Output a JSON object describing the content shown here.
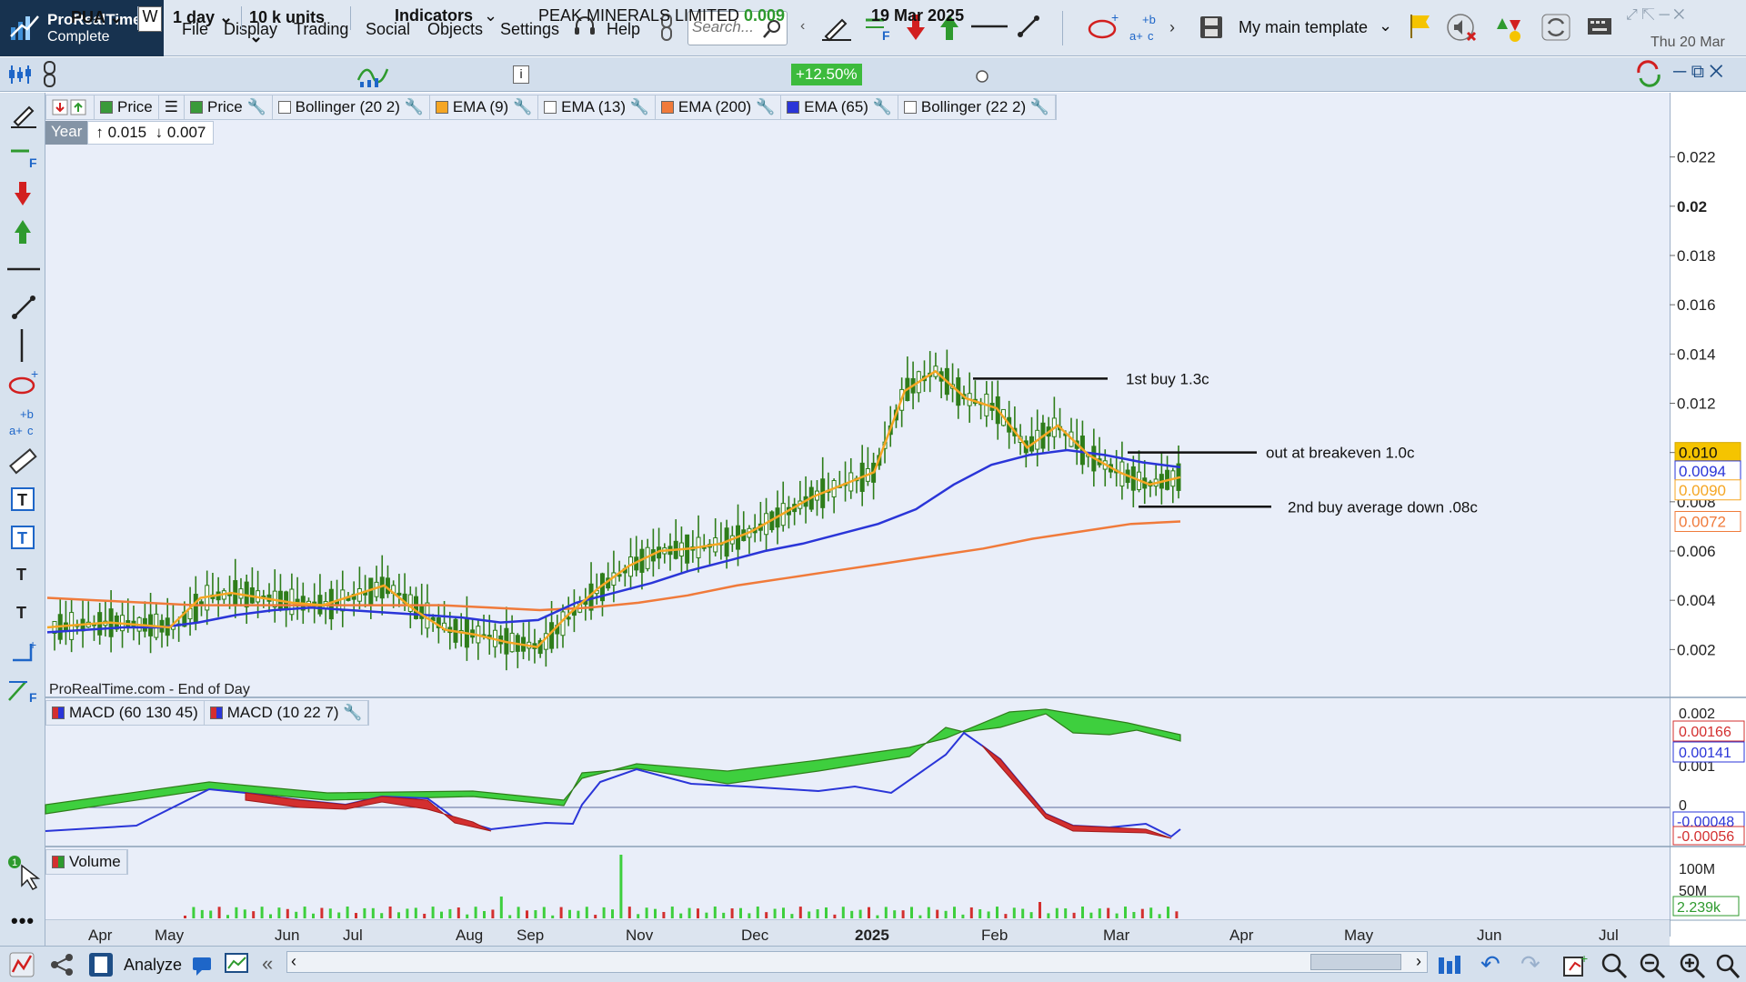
{
  "app": {
    "name": "ProRealTime",
    "edition": "Complete"
  },
  "menu": [
    "File",
    "Display",
    "Trading",
    "Social",
    "Objects",
    "Settings"
  ],
  "help_label": "Help",
  "search": {
    "placeholder": "Search..."
  },
  "template": "My main template",
  "date_label": "Thu 20 Mar",
  "toolbar": {
    "symbol": "PUA",
    "period_prefix": "W",
    "interval": "1 day",
    "units": "10 k units",
    "indicators_label": "Indicators",
    "instrument_name": "PEAK MINERALS LIMITED",
    "last_price": "0.009",
    "change_pct": "+12.50%",
    "bar_date": "19 Mar 2025"
  },
  "colors": {
    "up_bar": "#2e7d1a",
    "ema9": "#f5a623",
    "ema65": "#2a35d8",
    "ema200": "#f07a3a",
    "macd_fill_pos": "#3ecf3e",
    "macd_fill_neg": "#d32f2f",
    "accent": "#17324f"
  },
  "legend": [
    {
      "label": "Price",
      "swatch": "#3a9a3a"
    },
    {
      "label": "Price",
      "swatch": "#3a9a3a"
    },
    {
      "label": "Bollinger (20 2)",
      "swatch": "#ffffff"
    },
    {
      "label": "EMA (9)",
      "swatch": "#f5a623"
    },
    {
      "label": "EMA (13)",
      "swatch": "#ffffff"
    },
    {
      "label": "EMA (200)",
      "swatch": "#f07a3a"
    },
    {
      "label": "EMA (65)",
      "swatch": "#2a35d8"
    },
    {
      "label": "Bollinger (22 2)",
      "swatch": "#ffffff"
    }
  ],
  "range": {
    "label": "Year",
    "high": "0.015",
    "low": "0.007"
  },
  "footnote": "ProRealTime.com - End of Day",
  "macd_legend": [
    "MACD (60 130 45)",
    "MACD (10 22 7)"
  ],
  "volume_legend": "Volume",
  "bottom": {
    "analyze_label": "Analyze"
  },
  "chart_data": {
    "type": "candlestick",
    "price_axis": {
      "ticks": [
        "0.022",
        "0.02",
        "0.018",
        "0.016",
        "0.014",
        "0.012",
        "0.010",
        "0.008",
        "0.006",
        "0.004",
        "0.002"
      ],
      "ylim": [
        0.0005,
        0.0235
      ]
    },
    "x_labels": [
      "Apr",
      "May",
      "Jun",
      "Jul",
      "Aug",
      "Sep",
      "Nov",
      "Dec",
      "2025",
      "Feb",
      "Mar",
      "Apr",
      "May",
      "Jun",
      "Jul"
    ],
    "price_tags": [
      {
        "label": "0.010",
        "value": 0.01,
        "bg": "#f5c400",
        "fg": "#111111"
      },
      {
        "label": "0.0094",
        "value": 0.0094,
        "bg": "#ffffff",
        "fg": "#2a35d8"
      },
      {
        "label": "0.0090",
        "value": 0.009,
        "bg": "#ffffff",
        "fg": "#f5a623"
      },
      {
        "label": "0.0072",
        "value": 0.0072,
        "bg": "#ffffff",
        "fg": "#f07a3a"
      }
    ],
    "annotations": [
      {
        "text": "1st buy 1.3c",
        "level": 0.013
      },
      {
        "text": "out at breakeven 1.0c",
        "level": 0.01
      },
      {
        "text": "2nd buy average down .08c",
        "level": 0.0078
      }
    ],
    "ema9": [
      0.0029,
      0.003,
      0.0031,
      0.003,
      0.0029,
      0.0041,
      0.0043,
      0.0041,
      0.0039,
      0.0038,
      0.0042,
      0.0046,
      0.0036,
      0.0028,
      0.0026,
      0.0023,
      0.0021,
      0.0034,
      0.0045,
      0.0054,
      0.006,
      0.0061,
      0.0063,
      0.0068,
      0.0075,
      0.0082,
      0.0087,
      0.0092,
      0.0125,
      0.0133,
      0.0122,
      0.0118,
      0.0102,
      0.0111,
      0.0099,
      0.0092,
      0.0087,
      0.009
    ],
    "ema65": [
      0.0027,
      0.0028,
      0.0029,
      0.0029,
      0.0031,
      0.0034,
      0.0036,
      0.0037,
      0.0036,
      0.0035,
      0.0034,
      0.0033,
      0.0031,
      0.0032,
      0.0039,
      0.0043,
      0.0047,
      0.0052,
      0.0056,
      0.006,
      0.0063,
      0.0067,
      0.0071,
      0.0077,
      0.0087,
      0.0095,
      0.0099,
      0.0101,
      0.0099,
      0.0096,
      0.0094
    ],
    "ema200": [
      0.0041,
      0.004,
      0.0039,
      0.0038,
      0.0038,
      0.0038,
      0.0038,
      0.0038,
      0.0038,
      0.0037,
      0.0036,
      0.0037,
      0.0039,
      0.0042,
      0.0046,
      0.0049,
      0.0052,
      0.0055,
      0.0058,
      0.0061,
      0.0065,
      0.0068,
      0.0071,
      0.0072
    ],
    "macd_axis": {
      "labels": [
        "0.00166",
        "0.00141",
        "-0.00048",
        "-0.00056"
      ]
    },
    "volume_axis": {
      "labels": [
        "100M",
        "50M",
        "2.239k"
      ]
    }
  }
}
